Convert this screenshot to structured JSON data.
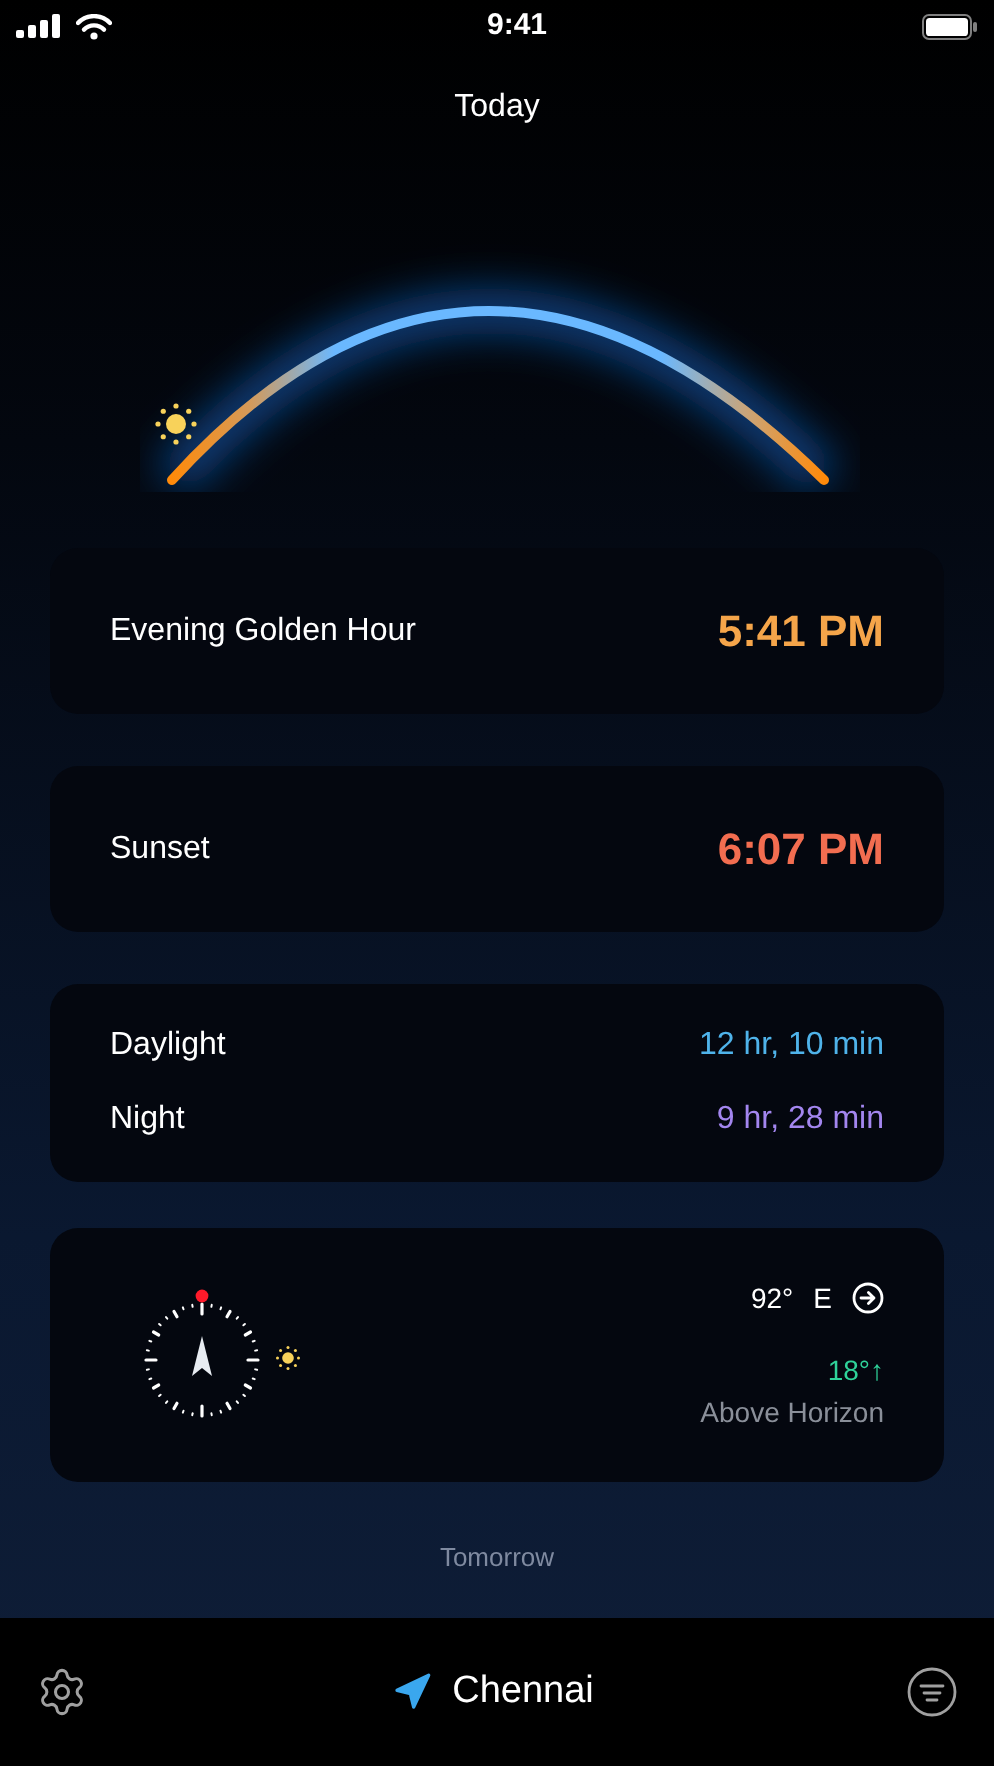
{
  "status_bar": {
    "time": "9:41"
  },
  "header": {
    "title": "Today"
  },
  "events": [
    {
      "label": "Evening Golden Hour",
      "time": "5:41 PM",
      "color": "#f5a54a"
    },
    {
      "label": "Sunset",
      "time": "6:07 PM",
      "color": "#f26d50"
    }
  ],
  "durations": [
    {
      "label": "Daylight",
      "value": "12 hr, 10 min",
      "color": "#4fb3ea"
    },
    {
      "label": "Night",
      "value": "9 hr, 28 min",
      "color": "#a386ef"
    }
  ],
  "sun_position": {
    "azimuth": "92°",
    "direction": "E",
    "elevation": "18°↑",
    "elevation_label": "Above Horizon"
  },
  "next_day": "Tomorrow",
  "bottom_bar": {
    "location": "Chennai"
  }
}
